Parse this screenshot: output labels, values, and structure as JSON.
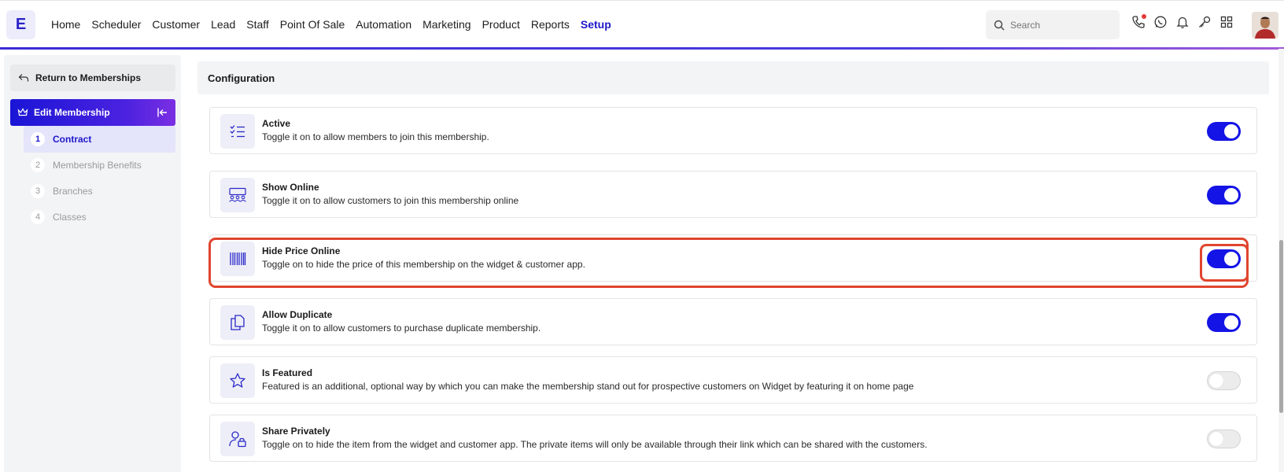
{
  "app": {
    "logo_letter": "E"
  },
  "nav": {
    "items": [
      {
        "label": "Home"
      },
      {
        "label": "Scheduler"
      },
      {
        "label": "Customer"
      },
      {
        "label": "Lead"
      },
      {
        "label": "Staff"
      },
      {
        "label": "Point Of Sale"
      },
      {
        "label": "Automation"
      },
      {
        "label": "Marketing"
      },
      {
        "label": "Product"
      },
      {
        "label": "Reports"
      },
      {
        "label": "Setup"
      }
    ],
    "active": "Setup"
  },
  "search": {
    "placeholder": "Search"
  },
  "header_icons": [
    "phone-icon",
    "whatsapp-icon",
    "bell-icon",
    "key-icon",
    "apps-grid-icon"
  ],
  "sidebar": {
    "return_label": "Return to Memberships",
    "edit_label": "Edit Membership",
    "steps": [
      {
        "num": "1",
        "label": "Contract"
      },
      {
        "num": "2",
        "label": "Membership Benefits"
      },
      {
        "num": "3",
        "label": "Branches"
      },
      {
        "num": "4",
        "label": "Classes"
      }
    ]
  },
  "main": {
    "section_title": "Configuration",
    "rows": [
      {
        "title": "Active",
        "desc": "Toggle it on to allow members to join this membership.",
        "icon": "checklist-icon",
        "enabled": true
      },
      {
        "title": "Show Online",
        "desc": "Toggle it on to allow customers to join this membership online",
        "icon": "audience-icon",
        "enabled": true
      },
      {
        "title": "Hide Price Online",
        "desc": "Toggle on to hide the price of this membership on the widget & customer app.",
        "icon": "barcode-icon",
        "enabled": true
      },
      {
        "title": "Allow Duplicate",
        "desc": "Toggle it on to allow customers to purchase duplicate membership.",
        "icon": "duplicate-icon",
        "enabled": true
      },
      {
        "title": "Is Featured",
        "desc": "Featured is an additional, optional way by which you can make the membership stand out for prospective customers on Widget by featuring it on home page",
        "icon": "star-icon",
        "enabled": false
      },
      {
        "title": "Share Privately",
        "desc": "Toggle on to hide the item from the widget and customer app. The private items will only be available through their link which can be shared with the customers.",
        "icon": "private-user-icon",
        "enabled": false
      }
    ]
  },
  "colors": {
    "accent": "#1414e6",
    "highlight": "#e0452e"
  }
}
